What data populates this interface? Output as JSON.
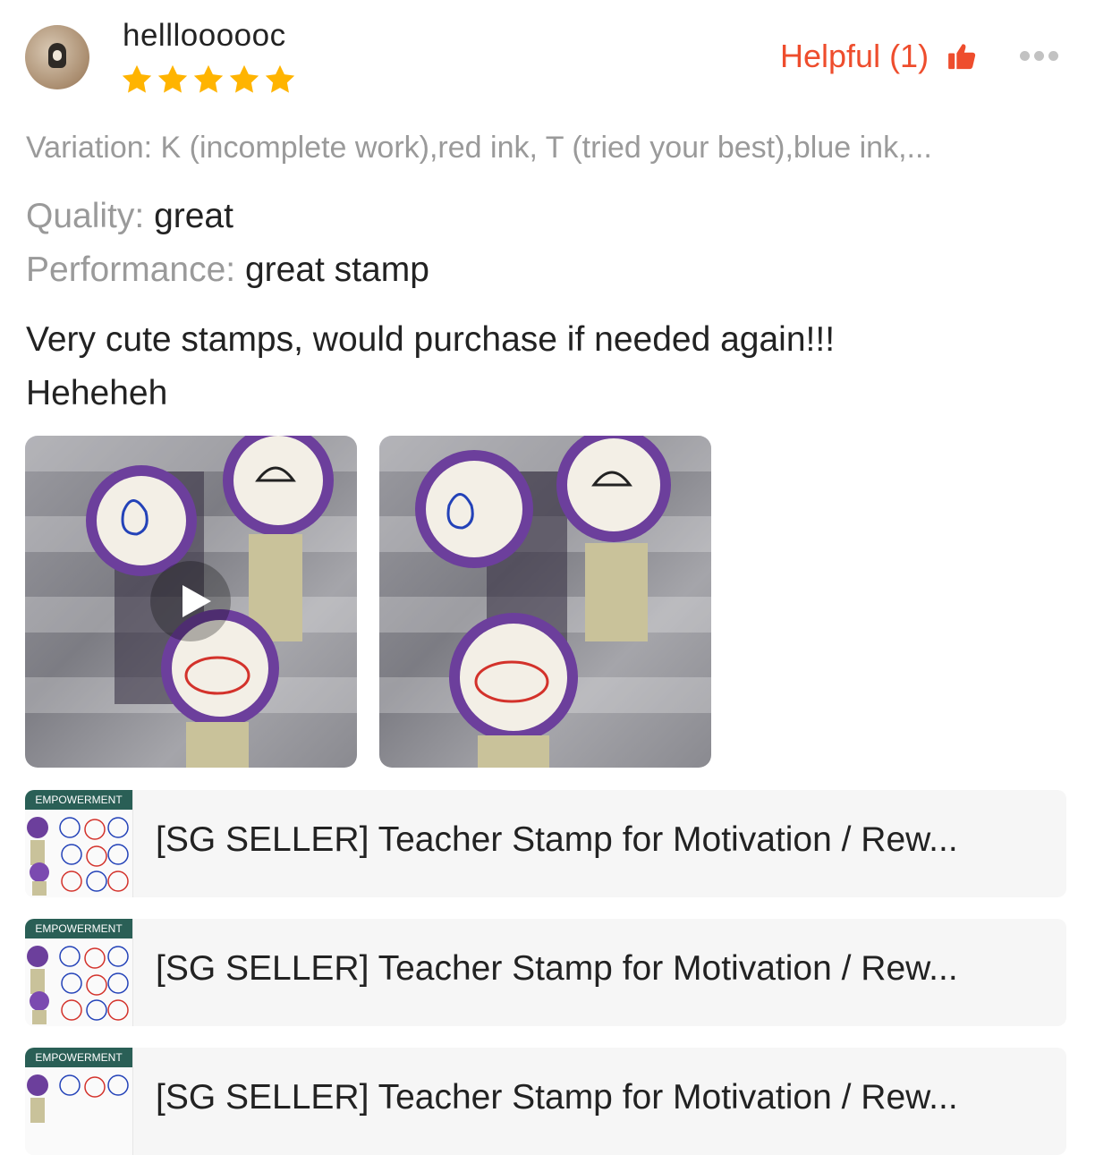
{
  "reviewer": {
    "name": "hellloooooc",
    "rating": 5,
    "avatar_icon": "avatar-icon"
  },
  "actions": {
    "helpful_label": "Helpful (1)",
    "helpful_icon": "thumbs-up-icon",
    "more_icon": "more-dots-icon"
  },
  "variation": "Variation: K (incomplete work),red ink, T (tried your best),blue ink,...",
  "attributes": [
    {
      "key": "Quality:",
      "value": "great"
    },
    {
      "key": "Performance:",
      "value": "great stamp"
    }
  ],
  "review_lines": [
    "Very cute stamps, would purchase if needed again!!!",
    "Heheheh"
  ],
  "media": [
    {
      "kind": "video",
      "icon": "play-icon"
    },
    {
      "kind": "photo"
    }
  ],
  "products": [
    {
      "tag": "EMPOWERMENT",
      "title": "[SG SELLER] Teacher Stamp for Motivation / Rew..."
    },
    {
      "tag": "EMPOWERMENT",
      "title": "[SG SELLER] Teacher Stamp for Motivation / Rew..."
    },
    {
      "tag": "EMPOWERMENT",
      "title": "[SG SELLER] Teacher Stamp for Motivation / Rew..."
    }
  ],
  "colors": {
    "accent": "#ee4d2d",
    "star": "#ffb400",
    "tag_bg": "#2a5f56",
    "muted": "#9a9a9a"
  }
}
